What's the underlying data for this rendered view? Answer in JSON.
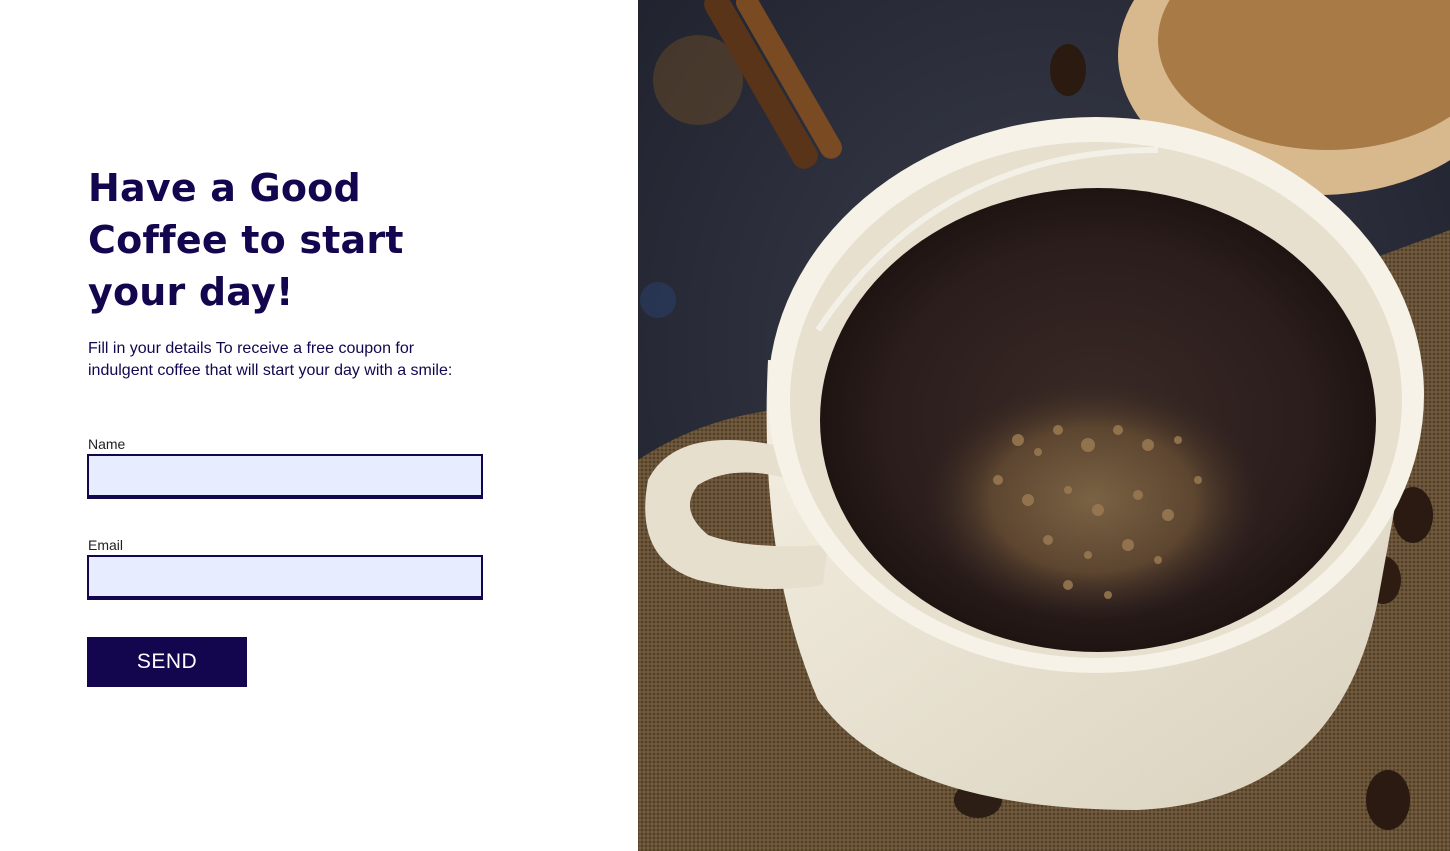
{
  "hero": {
    "headline": "Have a Good Coffee to start your day!",
    "subtitle": "Fill in your details To receive a free coupon for indulgent coffee that will start your day with a smile:"
  },
  "form": {
    "name_label": "Name",
    "name_value": "",
    "email_label": "Email",
    "email_value": "",
    "send_label": "SEND"
  },
  "colors": {
    "brand_navy": "#13064f",
    "input_fill": "#e7ecff",
    "background": "#ffffff"
  }
}
